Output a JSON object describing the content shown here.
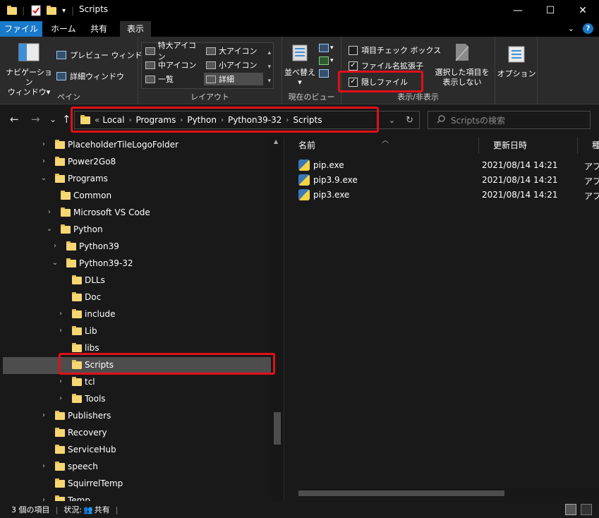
{
  "window": {
    "title": "Scripts",
    "minimize": "—",
    "maximize": "☐",
    "close": "✕"
  },
  "tabs": {
    "file": "ファイル",
    "home": "ホーム",
    "share": "共有",
    "view": "表示"
  },
  "ribbon": {
    "pane": {
      "nav_pane_line1": "ナビゲーション",
      "nav_pane_line2": "ウィンドウ",
      "preview_pane": "プレビュー ウィンドウ",
      "details_pane": "詳細ウィンドウ",
      "label": "ペイン"
    },
    "layout": {
      "extra_large": "特大アイコン",
      "large": "大アイコン",
      "medium": "中アイコン",
      "small": "小アイコン",
      "list": "一覧",
      "details": "詳細",
      "label": "レイアウト"
    },
    "current_view": {
      "sort_by": "並べ替え",
      "label": "現在のビュー"
    },
    "show_hide": {
      "item_checkbox": "項目チェック ボックス",
      "item_checkbox_checked": false,
      "file_ext": "ファイル名拡張子",
      "file_ext_checked": true,
      "hidden_items": "隠しファイル",
      "hidden_items_checked": true,
      "hide_selected_line1": "選択した項目を",
      "hide_selected_line2": "表示しない",
      "label": "表示/非表示"
    },
    "options": "オプション"
  },
  "nav": {
    "back": "←",
    "forward": "→",
    "recent": "⌄",
    "up": "↑",
    "overflow": "«",
    "breadcrumbs": [
      "Local",
      "Programs",
      "Python",
      "Python39-32",
      "Scripts"
    ],
    "search_placeholder": "Scriptsの検索"
  },
  "tree": [
    {
      "label": "PlaceholderTileLogoFolder",
      "expand": "›",
      "selected": false
    },
    {
      "label": "Power2Go8",
      "expand": "›",
      "selected": false
    },
    {
      "label": "Programs",
      "expand": "⌄",
      "selected": false
    },
    {
      "label": "Common",
      "expand": "",
      "selected": false
    },
    {
      "label": "Microsoft VS Code",
      "expand": "›",
      "selected": false
    },
    {
      "label": "Python",
      "expand": "⌄",
      "selected": false
    },
    {
      "label": "Python39",
      "expand": "›",
      "selected": false
    },
    {
      "label": "Python39-32",
      "expand": "⌄",
      "selected": false
    },
    {
      "label": "DLLs",
      "expand": "",
      "selected": false
    },
    {
      "label": "Doc",
      "expand": "",
      "selected": false
    },
    {
      "label": "include",
      "expand": "›",
      "selected": false
    },
    {
      "label": "Lib",
      "expand": "›",
      "selected": false
    },
    {
      "label": "libs",
      "expand": "",
      "selected": false
    },
    {
      "label": "Scripts",
      "expand": "",
      "selected": true
    },
    {
      "label": "tcl",
      "expand": "›",
      "selected": false
    },
    {
      "label": "Tools",
      "expand": "›",
      "selected": false
    },
    {
      "label": "Publishers",
      "expand": "›",
      "selected": false
    },
    {
      "label": "Recovery",
      "expand": "",
      "selected": false
    },
    {
      "label": "ServiceHub",
      "expand": "",
      "selected": false
    },
    {
      "label": "speech",
      "expand": "›",
      "selected": false
    },
    {
      "label": "SquirrelTemp",
      "expand": "",
      "selected": false
    },
    {
      "label": "Temp",
      "expand": "›",
      "selected": false
    }
  ],
  "files": {
    "columns": {
      "name": "名前",
      "modified": "更新日時",
      "type": "種類"
    },
    "sort_indicator": "︿",
    "rows": [
      {
        "name": "pip.exe",
        "modified": "2021/08/14 14:21",
        "type": "アプリ"
      },
      {
        "name": "pip3.9.exe",
        "modified": "2021/08/14 14:21",
        "type": "アプリ"
      },
      {
        "name": "pip3.exe",
        "modified": "2021/08/14 14:21",
        "type": "アプリ"
      }
    ]
  },
  "status": {
    "count": "3 個の項目",
    "state_label": "状況:",
    "state_value": "共有"
  },
  "colors": {
    "accent": "#1979ca",
    "highlight_box": "#e0101a",
    "selection": "#4d4d4d",
    "folder": "#f7d774"
  }
}
